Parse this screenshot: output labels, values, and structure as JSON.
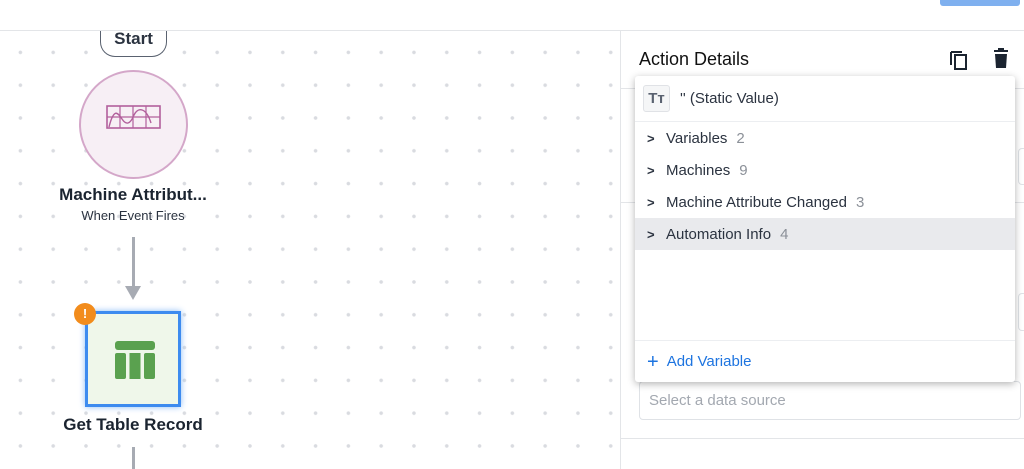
{
  "canvas": {
    "start_label": "Start",
    "trigger_node": {
      "title": "Machine Attribut...",
      "subtitle": "When Event Fires"
    },
    "action_node": {
      "title": "Get Table Record",
      "warning_icon": "warning-icon"
    }
  },
  "panel": {
    "title": "Action Details",
    "data_source_placeholder": "Select a data source"
  },
  "popup": {
    "static_value": "'' (Static Value)",
    "static_icon": "Tт",
    "groups": [
      {
        "label": "Variables",
        "count": "2"
      },
      {
        "label": "Machines",
        "count": "9"
      },
      {
        "label": "Machine Attribute Changed",
        "count": "3"
      },
      {
        "label": "Automation Info",
        "count": "4"
      }
    ],
    "add_variable": "Add Variable"
  },
  "colors": {
    "accent": "#1d74e0",
    "selection": "#3d8bef",
    "warning": "#f28c1c",
    "table_icon": "#5aa14f",
    "trigger": "#b2609c"
  }
}
